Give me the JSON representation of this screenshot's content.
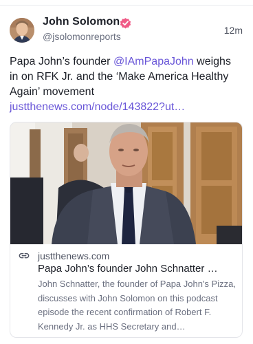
{
  "author": {
    "name": "John Solomon",
    "handle": "@jsolomonreports",
    "verified_color": "#f05a86"
  },
  "post": {
    "timestamp": "12m",
    "text_before": "Papa John’s founder ",
    "mention": "@IAmPapaJohn",
    "text_after": " weighs in on RFK Jr. and the ‘Make America Healthy Again’ movement ",
    "link_text": "justthenews.com/node/143822?ut…",
    "link_color": "#6a57d8"
  },
  "link_card": {
    "icon": "link-icon",
    "domain": "justthenews.com",
    "title": "Papa John’s founder John Schnatter …",
    "description": "John Schnatter, the founder of Papa John's Pizza, discusses with John Solomon on this podcast episode the recent confirmation of Robert F. Kennedy Jr. as HHS Secretary and…"
  }
}
